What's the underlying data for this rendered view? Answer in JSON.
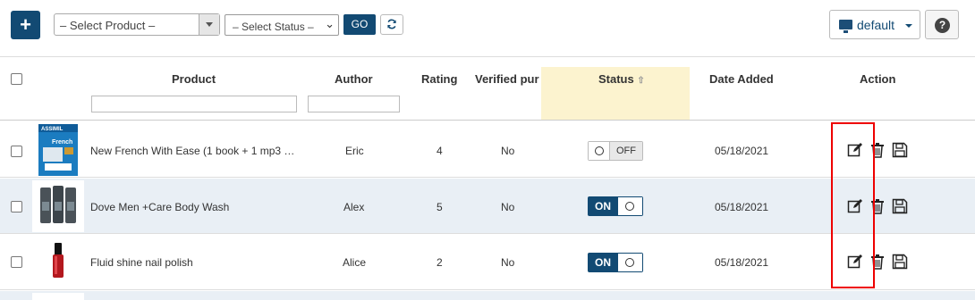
{
  "toolbar": {
    "add_label": "+",
    "product_select": "– Select Product –",
    "status_select": "– Select Status –",
    "go_label": "GO",
    "view_label": "default"
  },
  "table": {
    "headers": {
      "product": "Product",
      "author": "Author",
      "rating": "Rating",
      "verified": "Verified pur",
      "status": "Status",
      "date": "Date Added",
      "action": "Action"
    },
    "rows": [
      {
        "product": "New French With Ease (1 book + 1 mp3 …",
        "author": "Eric",
        "rating": "4",
        "verified": "No",
        "status": "OFF",
        "date": "05/18/2021"
      },
      {
        "product": "Dove Men +Care Body Wash",
        "author": "Alex",
        "rating": "5",
        "verified": "No",
        "status": "ON",
        "date": "05/18/2021"
      },
      {
        "product": "Fluid shine nail polish",
        "author": "Alice",
        "rating": "2",
        "verified": "No",
        "status": "ON",
        "date": "05/18/2021"
      }
    ]
  },
  "colors": {
    "primary": "#124a73",
    "status_column": "#fcf3cf",
    "row_alt": "#e9eff5",
    "highlight": "#ee0000"
  },
  "icons": [
    "plus-icon",
    "refresh-icon",
    "monitor-icon",
    "help-icon",
    "edit-icon",
    "trash-icon",
    "save-icon",
    "sort-asc-icon"
  ]
}
